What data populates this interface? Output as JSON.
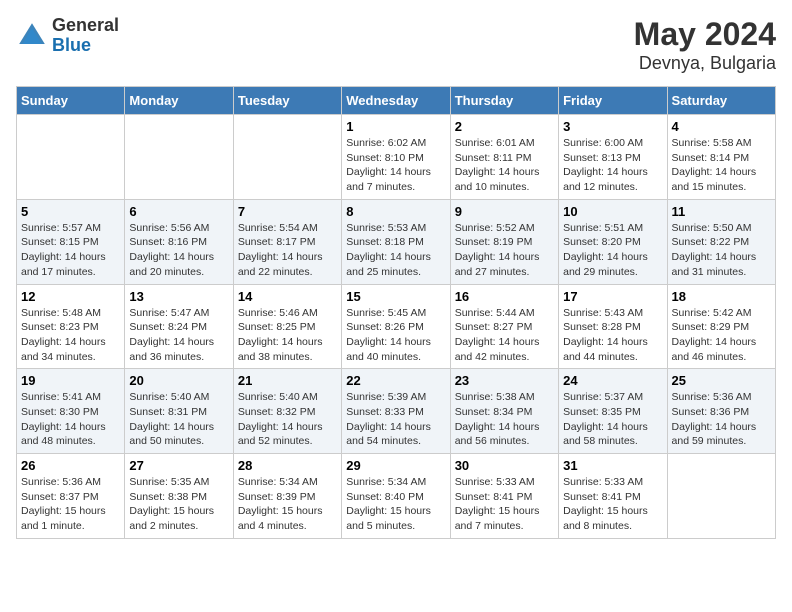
{
  "header": {
    "logo_general": "General",
    "logo_blue": "Blue",
    "month_year": "May 2024",
    "location": "Devnya, Bulgaria"
  },
  "days_of_week": [
    "Sunday",
    "Monday",
    "Tuesday",
    "Wednesday",
    "Thursday",
    "Friday",
    "Saturday"
  ],
  "weeks": [
    [
      {
        "day": "",
        "sunrise": "",
        "sunset": "",
        "daylight": ""
      },
      {
        "day": "",
        "sunrise": "",
        "sunset": "",
        "daylight": ""
      },
      {
        "day": "",
        "sunrise": "",
        "sunset": "",
        "daylight": ""
      },
      {
        "day": "1",
        "sunrise": "Sunrise: 6:02 AM",
        "sunset": "Sunset: 8:10 PM",
        "daylight": "Daylight: 14 hours and 7 minutes."
      },
      {
        "day": "2",
        "sunrise": "Sunrise: 6:01 AM",
        "sunset": "Sunset: 8:11 PM",
        "daylight": "Daylight: 14 hours and 10 minutes."
      },
      {
        "day": "3",
        "sunrise": "Sunrise: 6:00 AM",
        "sunset": "Sunset: 8:13 PM",
        "daylight": "Daylight: 14 hours and 12 minutes."
      },
      {
        "day": "4",
        "sunrise": "Sunrise: 5:58 AM",
        "sunset": "Sunset: 8:14 PM",
        "daylight": "Daylight: 14 hours and 15 minutes."
      }
    ],
    [
      {
        "day": "5",
        "sunrise": "Sunrise: 5:57 AM",
        "sunset": "Sunset: 8:15 PM",
        "daylight": "Daylight: 14 hours and 17 minutes."
      },
      {
        "day": "6",
        "sunrise": "Sunrise: 5:56 AM",
        "sunset": "Sunset: 8:16 PM",
        "daylight": "Daylight: 14 hours and 20 minutes."
      },
      {
        "day": "7",
        "sunrise": "Sunrise: 5:54 AM",
        "sunset": "Sunset: 8:17 PM",
        "daylight": "Daylight: 14 hours and 22 minutes."
      },
      {
        "day": "8",
        "sunrise": "Sunrise: 5:53 AM",
        "sunset": "Sunset: 8:18 PM",
        "daylight": "Daylight: 14 hours and 25 minutes."
      },
      {
        "day": "9",
        "sunrise": "Sunrise: 5:52 AM",
        "sunset": "Sunset: 8:19 PM",
        "daylight": "Daylight: 14 hours and 27 minutes."
      },
      {
        "day": "10",
        "sunrise": "Sunrise: 5:51 AM",
        "sunset": "Sunset: 8:20 PM",
        "daylight": "Daylight: 14 hours and 29 minutes."
      },
      {
        "day": "11",
        "sunrise": "Sunrise: 5:50 AM",
        "sunset": "Sunset: 8:22 PM",
        "daylight": "Daylight: 14 hours and 31 minutes."
      }
    ],
    [
      {
        "day": "12",
        "sunrise": "Sunrise: 5:48 AM",
        "sunset": "Sunset: 8:23 PM",
        "daylight": "Daylight: 14 hours and 34 minutes."
      },
      {
        "day": "13",
        "sunrise": "Sunrise: 5:47 AM",
        "sunset": "Sunset: 8:24 PM",
        "daylight": "Daylight: 14 hours and 36 minutes."
      },
      {
        "day": "14",
        "sunrise": "Sunrise: 5:46 AM",
        "sunset": "Sunset: 8:25 PM",
        "daylight": "Daylight: 14 hours and 38 minutes."
      },
      {
        "day": "15",
        "sunrise": "Sunrise: 5:45 AM",
        "sunset": "Sunset: 8:26 PM",
        "daylight": "Daylight: 14 hours and 40 minutes."
      },
      {
        "day": "16",
        "sunrise": "Sunrise: 5:44 AM",
        "sunset": "Sunset: 8:27 PM",
        "daylight": "Daylight: 14 hours and 42 minutes."
      },
      {
        "day": "17",
        "sunrise": "Sunrise: 5:43 AM",
        "sunset": "Sunset: 8:28 PM",
        "daylight": "Daylight: 14 hours and 44 minutes."
      },
      {
        "day": "18",
        "sunrise": "Sunrise: 5:42 AM",
        "sunset": "Sunset: 8:29 PM",
        "daylight": "Daylight: 14 hours and 46 minutes."
      }
    ],
    [
      {
        "day": "19",
        "sunrise": "Sunrise: 5:41 AM",
        "sunset": "Sunset: 8:30 PM",
        "daylight": "Daylight: 14 hours and 48 minutes."
      },
      {
        "day": "20",
        "sunrise": "Sunrise: 5:40 AM",
        "sunset": "Sunset: 8:31 PM",
        "daylight": "Daylight: 14 hours and 50 minutes."
      },
      {
        "day": "21",
        "sunrise": "Sunrise: 5:40 AM",
        "sunset": "Sunset: 8:32 PM",
        "daylight": "Daylight: 14 hours and 52 minutes."
      },
      {
        "day": "22",
        "sunrise": "Sunrise: 5:39 AM",
        "sunset": "Sunset: 8:33 PM",
        "daylight": "Daylight: 14 hours and 54 minutes."
      },
      {
        "day": "23",
        "sunrise": "Sunrise: 5:38 AM",
        "sunset": "Sunset: 8:34 PM",
        "daylight": "Daylight: 14 hours and 56 minutes."
      },
      {
        "day": "24",
        "sunrise": "Sunrise: 5:37 AM",
        "sunset": "Sunset: 8:35 PM",
        "daylight": "Daylight: 14 hours and 58 minutes."
      },
      {
        "day": "25",
        "sunrise": "Sunrise: 5:36 AM",
        "sunset": "Sunset: 8:36 PM",
        "daylight": "Daylight: 14 hours and 59 minutes."
      }
    ],
    [
      {
        "day": "26",
        "sunrise": "Sunrise: 5:36 AM",
        "sunset": "Sunset: 8:37 PM",
        "daylight": "Daylight: 15 hours and 1 minute."
      },
      {
        "day": "27",
        "sunrise": "Sunrise: 5:35 AM",
        "sunset": "Sunset: 8:38 PM",
        "daylight": "Daylight: 15 hours and 2 minutes."
      },
      {
        "day": "28",
        "sunrise": "Sunrise: 5:34 AM",
        "sunset": "Sunset: 8:39 PM",
        "daylight": "Daylight: 15 hours and 4 minutes."
      },
      {
        "day": "29",
        "sunrise": "Sunrise: 5:34 AM",
        "sunset": "Sunset: 8:40 PM",
        "daylight": "Daylight: 15 hours and 5 minutes."
      },
      {
        "day": "30",
        "sunrise": "Sunrise: 5:33 AM",
        "sunset": "Sunset: 8:41 PM",
        "daylight": "Daylight: 15 hours and 7 minutes."
      },
      {
        "day": "31",
        "sunrise": "Sunrise: 5:33 AM",
        "sunset": "Sunset: 8:41 PM",
        "daylight": "Daylight: 15 hours and 8 minutes."
      },
      {
        "day": "",
        "sunrise": "",
        "sunset": "",
        "daylight": ""
      }
    ]
  ]
}
